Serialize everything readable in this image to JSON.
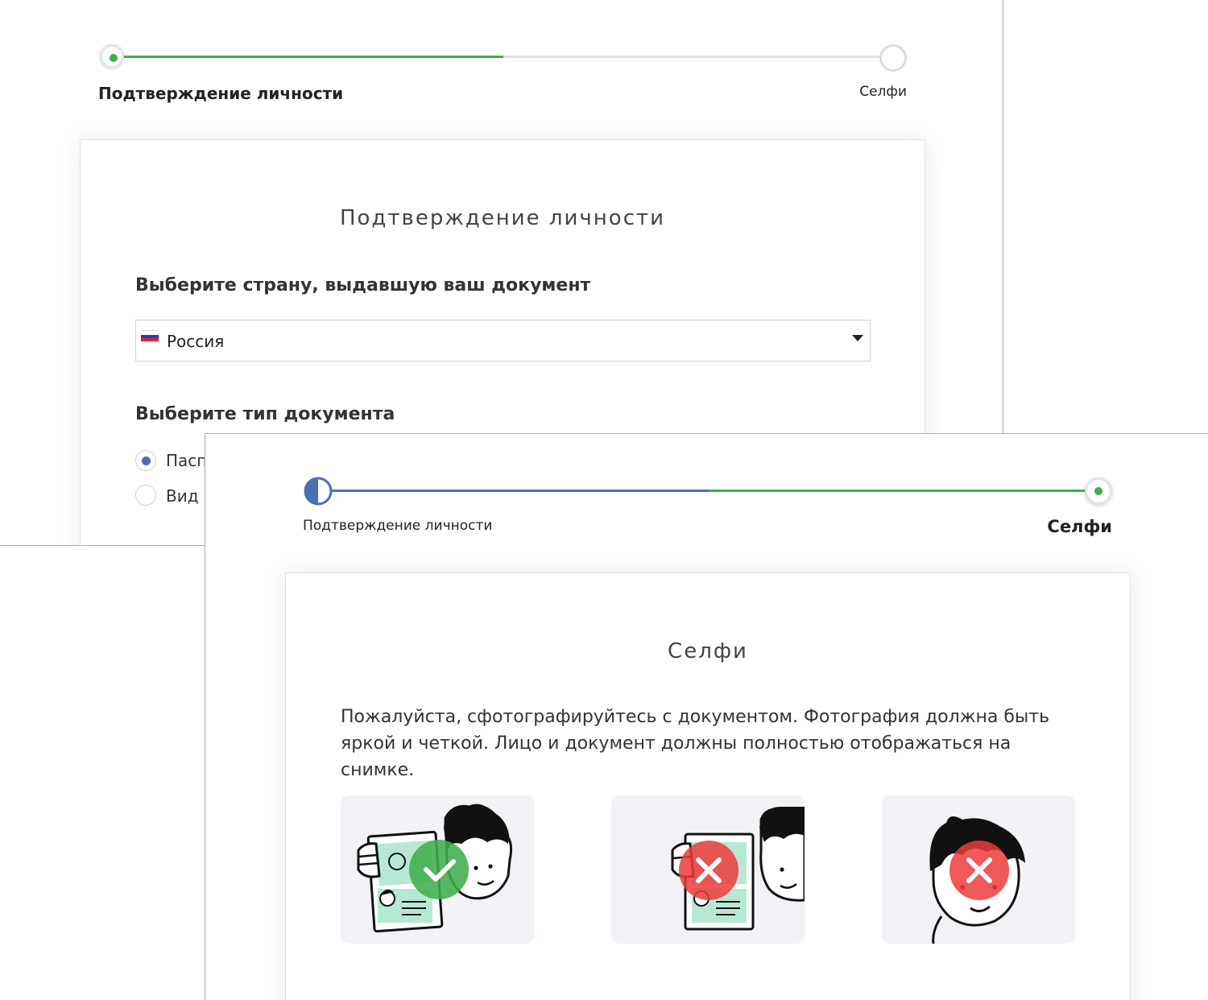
{
  "colors": {
    "green": "#3fae4a",
    "blue": "#4a6fb4",
    "red": "#ee3b3b",
    "track": "#e2e2e2"
  },
  "screen1": {
    "stepper": {
      "step1_label": "Подтверждение личности",
      "step2_label": "Селфи",
      "progress": 0.5
    },
    "card": {
      "title": "Подтверждение личности",
      "country_label": "Выберите страну, выдавшую ваш документ",
      "country_value": "Россия",
      "doctype_label": "Выберите тип документа",
      "options": [
        {
          "label": "Паспорт",
          "selected": true
        },
        {
          "label": "Вид на жительство",
          "selected": false
        }
      ]
    }
  },
  "screen2": {
    "stepper": {
      "step1_label": "Подтверждение личности",
      "step2_label": "Селфи"
    },
    "card": {
      "title": "Селфи",
      "instructions": "Пожалуйста, сфотографируйтесь с документом. Фотография должна быть яркой и четкой. Лицо и документ должны полностью отображаться на снимке.",
      "examples": [
        {
          "name": "correct-selfie",
          "status": "check-icon"
        },
        {
          "name": "document-covers-face",
          "status": "cross-icon"
        },
        {
          "name": "no-document",
          "status": "cross-icon"
        }
      ]
    }
  }
}
